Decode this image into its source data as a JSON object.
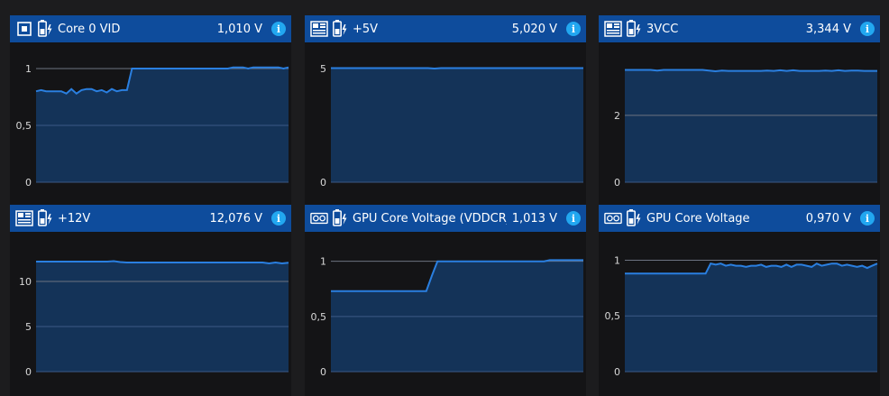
{
  "colors": {
    "header_bg": "#0e4c9c",
    "panel_bg": "#141416",
    "page_bg": "#1c1c1e",
    "area_fill": "#143358",
    "line": "#2a7fe0",
    "grid": "#3c5a86",
    "top_grid": "#6c7380",
    "info": "#22a7f0"
  },
  "panels": [
    {
      "title": "Core 0 VID",
      "value": "1,010 V",
      "hw_icon": "cpu-icon",
      "sensor_icon": "battery-voltage-icon",
      "info_icon": "info-icon",
      "chart_data": {
        "type": "area",
        "ylim": [
          0,
          1
        ],
        "yticks": [
          {
            "v": 0,
            "label": "0"
          },
          {
            "v": 0.5,
            "label": "0,5"
          },
          {
            "v": 1,
            "label": "1"
          }
        ],
        "values": [
          0.8,
          0.81,
          0.8,
          0.8,
          0.8,
          0.8,
          0.78,
          0.82,
          0.78,
          0.81,
          0.82,
          0.82,
          0.8,
          0.81,
          0.79,
          0.82,
          0.8,
          0.81,
          0.81,
          1.0,
          1.0,
          1.0,
          1.0,
          1.0,
          1.0,
          1.0,
          1.0,
          1.0,
          1.0,
          1.0,
          1.0,
          1.0,
          1.0,
          1.0,
          1.0,
          1.0,
          1.0,
          1.0,
          1.0,
          1.01,
          1.01,
          1.01,
          1.0,
          1.01,
          1.01,
          1.01,
          1.01,
          1.01,
          1.01,
          1.0,
          1.01
        ]
      }
    },
    {
      "title": "+5V",
      "value": "5,020 V",
      "hw_icon": "motherboard-icon",
      "sensor_icon": "battery-voltage-icon",
      "info_icon": "info-icon",
      "chart_data": {
        "type": "area",
        "ylim": [
          0,
          5
        ],
        "yticks": [
          {
            "v": 0,
            "label": "0"
          },
          {
            "v": 5,
            "label": "5"
          }
        ],
        "values": [
          5.02,
          5.02,
          5.02,
          5.02,
          5.02,
          5.02,
          5.02,
          5.02,
          5.02,
          5.02,
          5.02,
          5.02,
          5.02,
          5.02,
          5.02,
          5.02,
          5.0,
          5.02,
          5.02,
          5.02,
          5.02,
          5.02,
          5.02,
          5.02,
          5.02,
          5.02,
          5.02,
          5.02,
          5.02,
          5.02,
          5.02,
          5.02,
          5.02,
          5.02,
          5.02,
          5.02,
          5.02,
          5.02,
          5.02,
          5.02
        ]
      }
    },
    {
      "title": "3VCC",
      "value": "3,344 V",
      "hw_icon": "motherboard-icon",
      "sensor_icon": "battery-voltage-icon",
      "info_icon": "info-icon",
      "chart_data": {
        "type": "area",
        "ylim": [
          0,
          3.4
        ],
        "yticks": [
          {
            "v": 0,
            "label": "0"
          },
          {
            "v": 2,
            "label": "2"
          }
        ],
        "values": [
          3.36,
          3.36,
          3.36,
          3.36,
          3.36,
          3.34,
          3.36,
          3.36,
          3.36,
          3.36,
          3.36,
          3.36,
          3.36,
          3.34,
          3.32,
          3.34,
          3.33,
          3.33,
          3.33,
          3.33,
          3.33,
          3.33,
          3.34,
          3.33,
          3.35,
          3.33,
          3.35,
          3.33,
          3.33,
          3.33,
          3.33,
          3.34,
          3.33,
          3.35,
          3.33,
          3.34,
          3.34,
          3.33,
          3.33,
          3.33
        ]
      }
    },
    {
      "title": "+12V",
      "value": "12,076 V",
      "hw_icon": "motherboard-icon",
      "sensor_icon": "battery-voltage-icon",
      "info_icon": "info-icon",
      "chart_data": {
        "type": "area",
        "ylim": [
          0,
          12.6
        ],
        "yticks": [
          {
            "v": 0,
            "label": "0"
          },
          {
            "v": 5,
            "label": "5"
          },
          {
            "v": 10,
            "label": "10"
          }
        ],
        "values": [
          12.2,
          12.2,
          12.2,
          12.2,
          12.2,
          12.2,
          12.2,
          12.2,
          12.2,
          12.2,
          12.2,
          12.2,
          12.25,
          12.15,
          12.1,
          12.1,
          12.1,
          12.1,
          12.1,
          12.1,
          12.1,
          12.1,
          12.1,
          12.1,
          12.1,
          12.1,
          12.1,
          12.1,
          12.1,
          12.1,
          12.1,
          12.1,
          12.1,
          12.1,
          12.1,
          12.1,
          12.0,
          12.1,
          12.0,
          12.08
        ]
      }
    },
    {
      "title": "GPU Core Voltage (VDDCR_GFX)",
      "value": "1,013 V",
      "hw_icon": "gpu-icon",
      "sensor_icon": "battery-voltage-icon",
      "info_icon": "info-icon",
      "chart_data": {
        "type": "area",
        "ylim": [
          0,
          1.03
        ],
        "yticks": [
          {
            "v": 0,
            "label": "0"
          },
          {
            "v": 0.5,
            "label": "0,5"
          },
          {
            "v": 1,
            "label": "1"
          }
        ],
        "values": [
          0.73,
          0.73,
          0.73,
          0.73,
          0.73,
          0.73,
          0.73,
          0.73,
          0.73,
          0.73,
          0.73,
          0.73,
          0.73,
          0.73,
          0.73,
          0.73,
          0.73,
          0.73,
          0.87,
          1.0,
          1.0,
          1.0,
          1.0,
          1.0,
          1.0,
          1.0,
          1.0,
          1.0,
          1.0,
          1.0,
          1.0,
          1.0,
          1.0,
          1.0,
          1.0,
          1.0,
          1.0,
          1.0,
          1.0,
          1.01,
          1.01,
          1.01,
          1.01,
          1.01,
          1.01,
          1.01
        ]
      }
    },
    {
      "title": "GPU Core Voltage",
      "value": "0,970 V",
      "hw_icon": "gpu-icon",
      "sensor_icon": "battery-voltage-icon",
      "info_icon": "info-icon",
      "chart_data": {
        "type": "area",
        "ylim": [
          0,
          1.02
        ],
        "yticks": [
          {
            "v": 0,
            "label": "0"
          },
          {
            "v": 0.5,
            "label": "0,5"
          },
          {
            "v": 1,
            "label": "1"
          }
        ],
        "values": [
          0.88,
          0.88,
          0.88,
          0.88,
          0.88,
          0.88,
          0.88,
          0.88,
          0.88,
          0.88,
          0.88,
          0.88,
          0.88,
          0.88,
          0.88,
          0.88,
          0.88,
          0.97,
          0.96,
          0.97,
          0.95,
          0.96,
          0.95,
          0.95,
          0.94,
          0.95,
          0.95,
          0.96,
          0.94,
          0.95,
          0.95,
          0.94,
          0.96,
          0.94,
          0.96,
          0.96,
          0.95,
          0.94,
          0.97,
          0.95,
          0.96,
          0.97,
          0.97,
          0.95,
          0.96,
          0.95,
          0.94,
          0.95,
          0.93,
          0.95,
          0.97
        ]
      }
    }
  ]
}
